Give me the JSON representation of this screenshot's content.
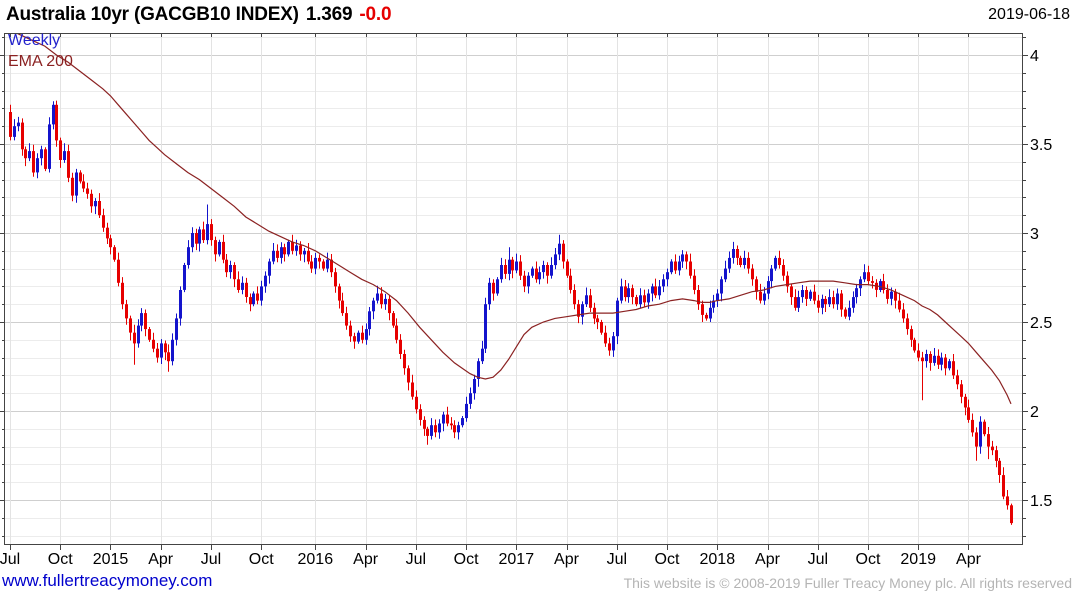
{
  "header": {
    "title": "Australia 10yr (GACGB10 INDEX)",
    "last_value": "1.369",
    "change": "-0.0",
    "date": "2019-06-18"
  },
  "footer": {
    "link": "www.fullertreacymoney.com",
    "copyright": "This website is © 2008-2019 Fuller Treacy Money plc. All rights reserved"
  },
  "chart_data": {
    "type": "candlestick",
    "instrument": "Australia 10yr (GACGB10 INDEX)",
    "interval": "Weekly",
    "overlay_label": "EMA 200",
    "ylim": [
      1.25,
      4.12
    ],
    "y_ticks": [
      4,
      3.5,
      3,
      2.5,
      2,
      1.5
    ],
    "y_tick_labels": [
      "4",
      "3.5",
      "3",
      "2.5",
      "2",
      "1.5"
    ],
    "y_minor_step": 0.1,
    "x_ticks": [
      [
        0,
        "Jul"
      ],
      [
        13,
        "Oct"
      ],
      [
        26,
        "2015"
      ],
      [
        39,
        "Apr"
      ],
      [
        52,
        "Jul"
      ],
      [
        65,
        "Oct"
      ],
      [
        79,
        "2016"
      ],
      [
        92,
        "Apr"
      ],
      [
        105,
        "Jul"
      ],
      [
        118,
        "Oct"
      ],
      [
        131,
        "2017"
      ],
      [
        144,
        "Apr"
      ],
      [
        157,
        "Jul"
      ],
      [
        170,
        "Oct"
      ],
      [
        183,
        "2018"
      ],
      [
        196,
        "Apr"
      ],
      [
        209,
        "Jul"
      ],
      [
        222,
        "Oct"
      ],
      [
        235,
        "2019"
      ],
      [
        248,
        "Apr"
      ]
    ],
    "weeks_total": 260,
    "first_open": 3.68,
    "closes": [
      3.54,
      3.6,
      3.62,
      3.47,
      3.42,
      3.46,
      3.34,
      3.42,
      3.47,
      3.36,
      3.61,
      3.72,
      3.52,
      3.41,
      3.46,
      3.31,
      3.21,
      3.34,
      3.29,
      3.25,
      3.22,
      3.15,
      3.18,
      3.1,
      3.03,
      2.97,
      2.92,
      2.85,
      2.72,
      2.6,
      2.52,
      2.44,
      2.38,
      2.48,
      2.55,
      2.46,
      2.4,
      2.35,
      2.3,
      2.38,
      2.33,
      2.28,
      2.4,
      2.52,
      2.68,
      2.82,
      2.92,
      3.0,
      2.94,
      3.02,
      2.96,
      3.05,
      2.96,
      2.88,
      2.95,
      2.85,
      2.78,
      2.82,
      2.74,
      2.68,
      2.72,
      2.64,
      2.6,
      2.66,
      2.62,
      2.7,
      2.76,
      2.84,
      2.9,
      2.86,
      2.92,
      2.88,
      2.95,
      2.9,
      2.93,
      2.88,
      2.9,
      2.84,
      2.8,
      2.86,
      2.84,
      2.8,
      2.85,
      2.78,
      2.7,
      2.62,
      2.55,
      2.48,
      2.42,
      2.39,
      2.44,
      2.4,
      2.46,
      2.56,
      2.62,
      2.66,
      2.6,
      2.63,
      2.55,
      2.48,
      2.4,
      2.32,
      2.24,
      2.16,
      2.08,
      2.01,
      1.95,
      1.9,
      1.86,
      1.92,
      1.88,
      1.93,
      1.98,
      1.93,
      1.92,
      1.88,
      1.92,
      1.96,
      2.04,
      2.1,
      2.18,
      2.28,
      2.35,
      2.6,
      2.72,
      2.66,
      2.74,
      2.82,
      2.77,
      2.85,
      2.79,
      2.84,
      2.76,
      2.7,
      2.76,
      2.8,
      2.74,
      2.78,
      2.82,
      2.76,
      2.82,
      2.88,
      2.94,
      2.84,
      2.76,
      2.68,
      2.6,
      2.53,
      2.6,
      2.65,
      2.58,
      2.52,
      2.5,
      2.44,
      2.38,
      2.34,
      2.42,
      2.62,
      2.7,
      2.64,
      2.69,
      2.64,
      2.6,
      2.65,
      2.61,
      2.66,
      2.7,
      2.65,
      2.7,
      2.74,
      2.78,
      2.84,
      2.79,
      2.84,
      2.88,
      2.84,
      2.76,
      2.68,
      2.6,
      2.54,
      2.52,
      2.58,
      2.62,
      2.66,
      2.74,
      2.8,
      2.86,
      2.91,
      2.86,
      2.82,
      2.86,
      2.8,
      2.74,
      2.67,
      2.62,
      2.66,
      2.73,
      2.8,
      2.86,
      2.82,
      2.76,
      2.7,
      2.64,
      2.58,
      2.64,
      2.68,
      2.63,
      2.67,
      2.62,
      2.58,
      2.63,
      2.6,
      2.64,
      2.6,
      2.66,
      2.57,
      2.53,
      2.58,
      2.64,
      2.69,
      2.74,
      2.78,
      2.73,
      2.72,
      2.68,
      2.73,
      2.68,
      2.63,
      2.67,
      2.62,
      2.57,
      2.52,
      2.46,
      2.4,
      2.34,
      2.3,
      2.28,
      2.32,
      2.27,
      2.31,
      2.26,
      2.3,
      2.24,
      2.28,
      2.2,
      2.15,
      2.08,
      2.02,
      1.95,
      1.88,
      1.8,
      1.94,
      1.87,
      1.8,
      1.78,
      1.72,
      1.64,
      1.52,
      1.47,
      1.37
    ],
    "wick_overrides": {
      "0": {
        "h": 3.72,
        "l": 3.52
      },
      "11": {
        "h": 3.74
      },
      "32": {
        "l": 2.26
      },
      "41": {
        "l": 2.22
      },
      "51": {
        "h": 3.16
      },
      "108": {
        "l": 1.81
      },
      "129": {
        "h": 2.92
      },
      "142": {
        "h": 2.99
      },
      "155": {
        "l": 2.31
      },
      "187": {
        "h": 2.95
      },
      "236": {
        "l": 2.06
      },
      "250": {
        "l": 1.72
      },
      "251": {
        "h": 1.97
      },
      "253": {
        "l": 1.73
      },
      "259": {
        "h": 1.48,
        "l": 1.36
      }
    },
    "ema_points": [
      [
        0,
        4.14
      ],
      [
        3,
        4.11
      ],
      [
        6,
        4.08
      ],
      [
        9,
        4.05
      ],
      [
        12,
        4.0
      ],
      [
        15,
        3.96
      ],
      [
        18,
        3.91
      ],
      [
        21,
        3.86
      ],
      [
        24,
        3.81
      ],
      [
        26,
        3.77
      ],
      [
        28,
        3.72
      ],
      [
        30,
        3.67
      ],
      [
        32,
        3.62
      ],
      [
        34,
        3.57
      ],
      [
        36,
        3.52
      ],
      [
        38,
        3.48
      ],
      [
        40,
        3.44
      ],
      [
        43,
        3.39
      ],
      [
        46,
        3.34
      ],
      [
        49,
        3.3
      ],
      [
        52,
        3.25
      ],
      [
        55,
        3.2
      ],
      [
        58,
        3.15
      ],
      [
        61,
        3.09
      ],
      [
        64,
        3.05
      ],
      [
        67,
        3.01
      ],
      [
        70,
        2.98
      ],
      [
        73,
        2.95
      ],
      [
        76,
        2.93
      ],
      [
        79,
        2.9
      ],
      [
        82,
        2.86
      ],
      [
        85,
        2.82
      ],
      [
        88,
        2.78
      ],
      [
        91,
        2.74
      ],
      [
        94,
        2.71
      ],
      [
        97,
        2.67
      ],
      [
        100,
        2.62
      ],
      [
        103,
        2.55
      ],
      [
        106,
        2.47
      ],
      [
        109,
        2.4
      ],
      [
        112,
        2.33
      ],
      [
        115,
        2.27
      ],
      [
        117,
        2.24
      ],
      [
        119,
        2.21
      ],
      [
        121,
        2.19
      ],
      [
        123,
        2.18
      ],
      [
        125,
        2.19
      ],
      [
        127,
        2.23
      ],
      [
        129,
        2.29
      ],
      [
        131,
        2.36
      ],
      [
        133,
        2.43
      ],
      [
        135,
        2.47
      ],
      [
        138,
        2.5
      ],
      [
        141,
        2.52
      ],
      [
        144,
        2.53
      ],
      [
        147,
        2.54
      ],
      [
        150,
        2.55
      ],
      [
        153,
        2.55
      ],
      [
        156,
        2.55
      ],
      [
        159,
        2.56
      ],
      [
        162,
        2.57
      ],
      [
        165,
        2.59
      ],
      [
        168,
        2.6
      ],
      [
        171,
        2.62
      ],
      [
        174,
        2.63
      ],
      [
        177,
        2.62
      ],
      [
        179,
        2.61
      ],
      [
        181,
        2.61
      ],
      [
        183,
        2.62
      ],
      [
        186,
        2.63
      ],
      [
        189,
        2.65
      ],
      [
        192,
        2.67
      ],
      [
        195,
        2.68
      ],
      [
        198,
        2.7
      ],
      [
        201,
        2.71
      ],
      [
        204,
        2.72
      ],
      [
        207,
        2.73
      ],
      [
        210,
        2.73
      ],
      [
        213,
        2.73
      ],
      [
        216,
        2.72
      ],
      [
        219,
        2.71
      ],
      [
        222,
        2.71
      ],
      [
        225,
        2.7
      ],
      [
        228,
        2.68
      ],
      [
        231,
        2.65
      ],
      [
        234,
        2.62
      ],
      [
        236,
        2.59
      ],
      [
        238,
        2.57
      ],
      [
        240,
        2.54
      ],
      [
        242,
        2.5
      ],
      [
        244,
        2.46
      ],
      [
        246,
        2.42
      ],
      [
        248,
        2.38
      ],
      [
        250,
        2.33
      ],
      [
        252,
        2.28
      ],
      [
        254,
        2.23
      ],
      [
        256,
        2.17
      ],
      [
        258,
        2.09
      ],
      [
        259,
        2.04
      ]
    ],
    "colors": {
      "up": "#1414cc",
      "down": "#e60000",
      "ema": "#8b2222",
      "grid_minor": "#ececec",
      "grid_major": "#cfcfcf",
      "grid_vert": "#e3e3e3",
      "border": "#444444",
      "title_change": "#e60000",
      "legend_interval": "#2222cc",
      "legend_ema": "#8b2222",
      "footer_link": "#0000cc",
      "footer_copy": "#b4b4b4"
    }
  }
}
